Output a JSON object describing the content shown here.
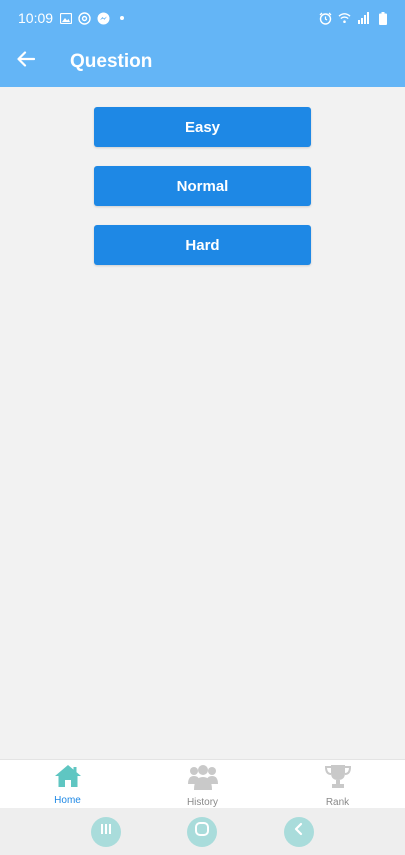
{
  "status_bar": {
    "time": "10:09",
    "left_icons": [
      "image-icon",
      "at-sign-icon",
      "messenger-icon",
      "dot-icon"
    ],
    "right_icons": [
      "alarm-icon",
      "wifi-icon",
      "signal-icon",
      "battery-icon"
    ]
  },
  "app_bar": {
    "title": "Question",
    "back_icon": "arrow-left-icon"
  },
  "levels": [
    {
      "label": "Easy"
    },
    {
      "label": "Normal"
    },
    {
      "label": "Hard"
    }
  ],
  "bottom_nav": {
    "items": [
      {
        "label": "Home",
        "icon": "home-icon",
        "active": true
      },
      {
        "label": "History",
        "icon": "group-icon",
        "active": false
      },
      {
        "label": "Rank",
        "icon": "trophy-icon",
        "active": false
      }
    ]
  },
  "colors": {
    "header": "#64b5f6",
    "button": "#1e88e5",
    "background": "#f2f2f2",
    "active_nav": "#1e88e5",
    "inactive_nav": "#8a8a8a",
    "home_icon": "#5fc6c2",
    "system_buttons": "#a9dcdb"
  },
  "system_nav": {
    "buttons": [
      "recent-apps-icon",
      "home-circle-icon",
      "back-chevron-icon"
    ]
  }
}
